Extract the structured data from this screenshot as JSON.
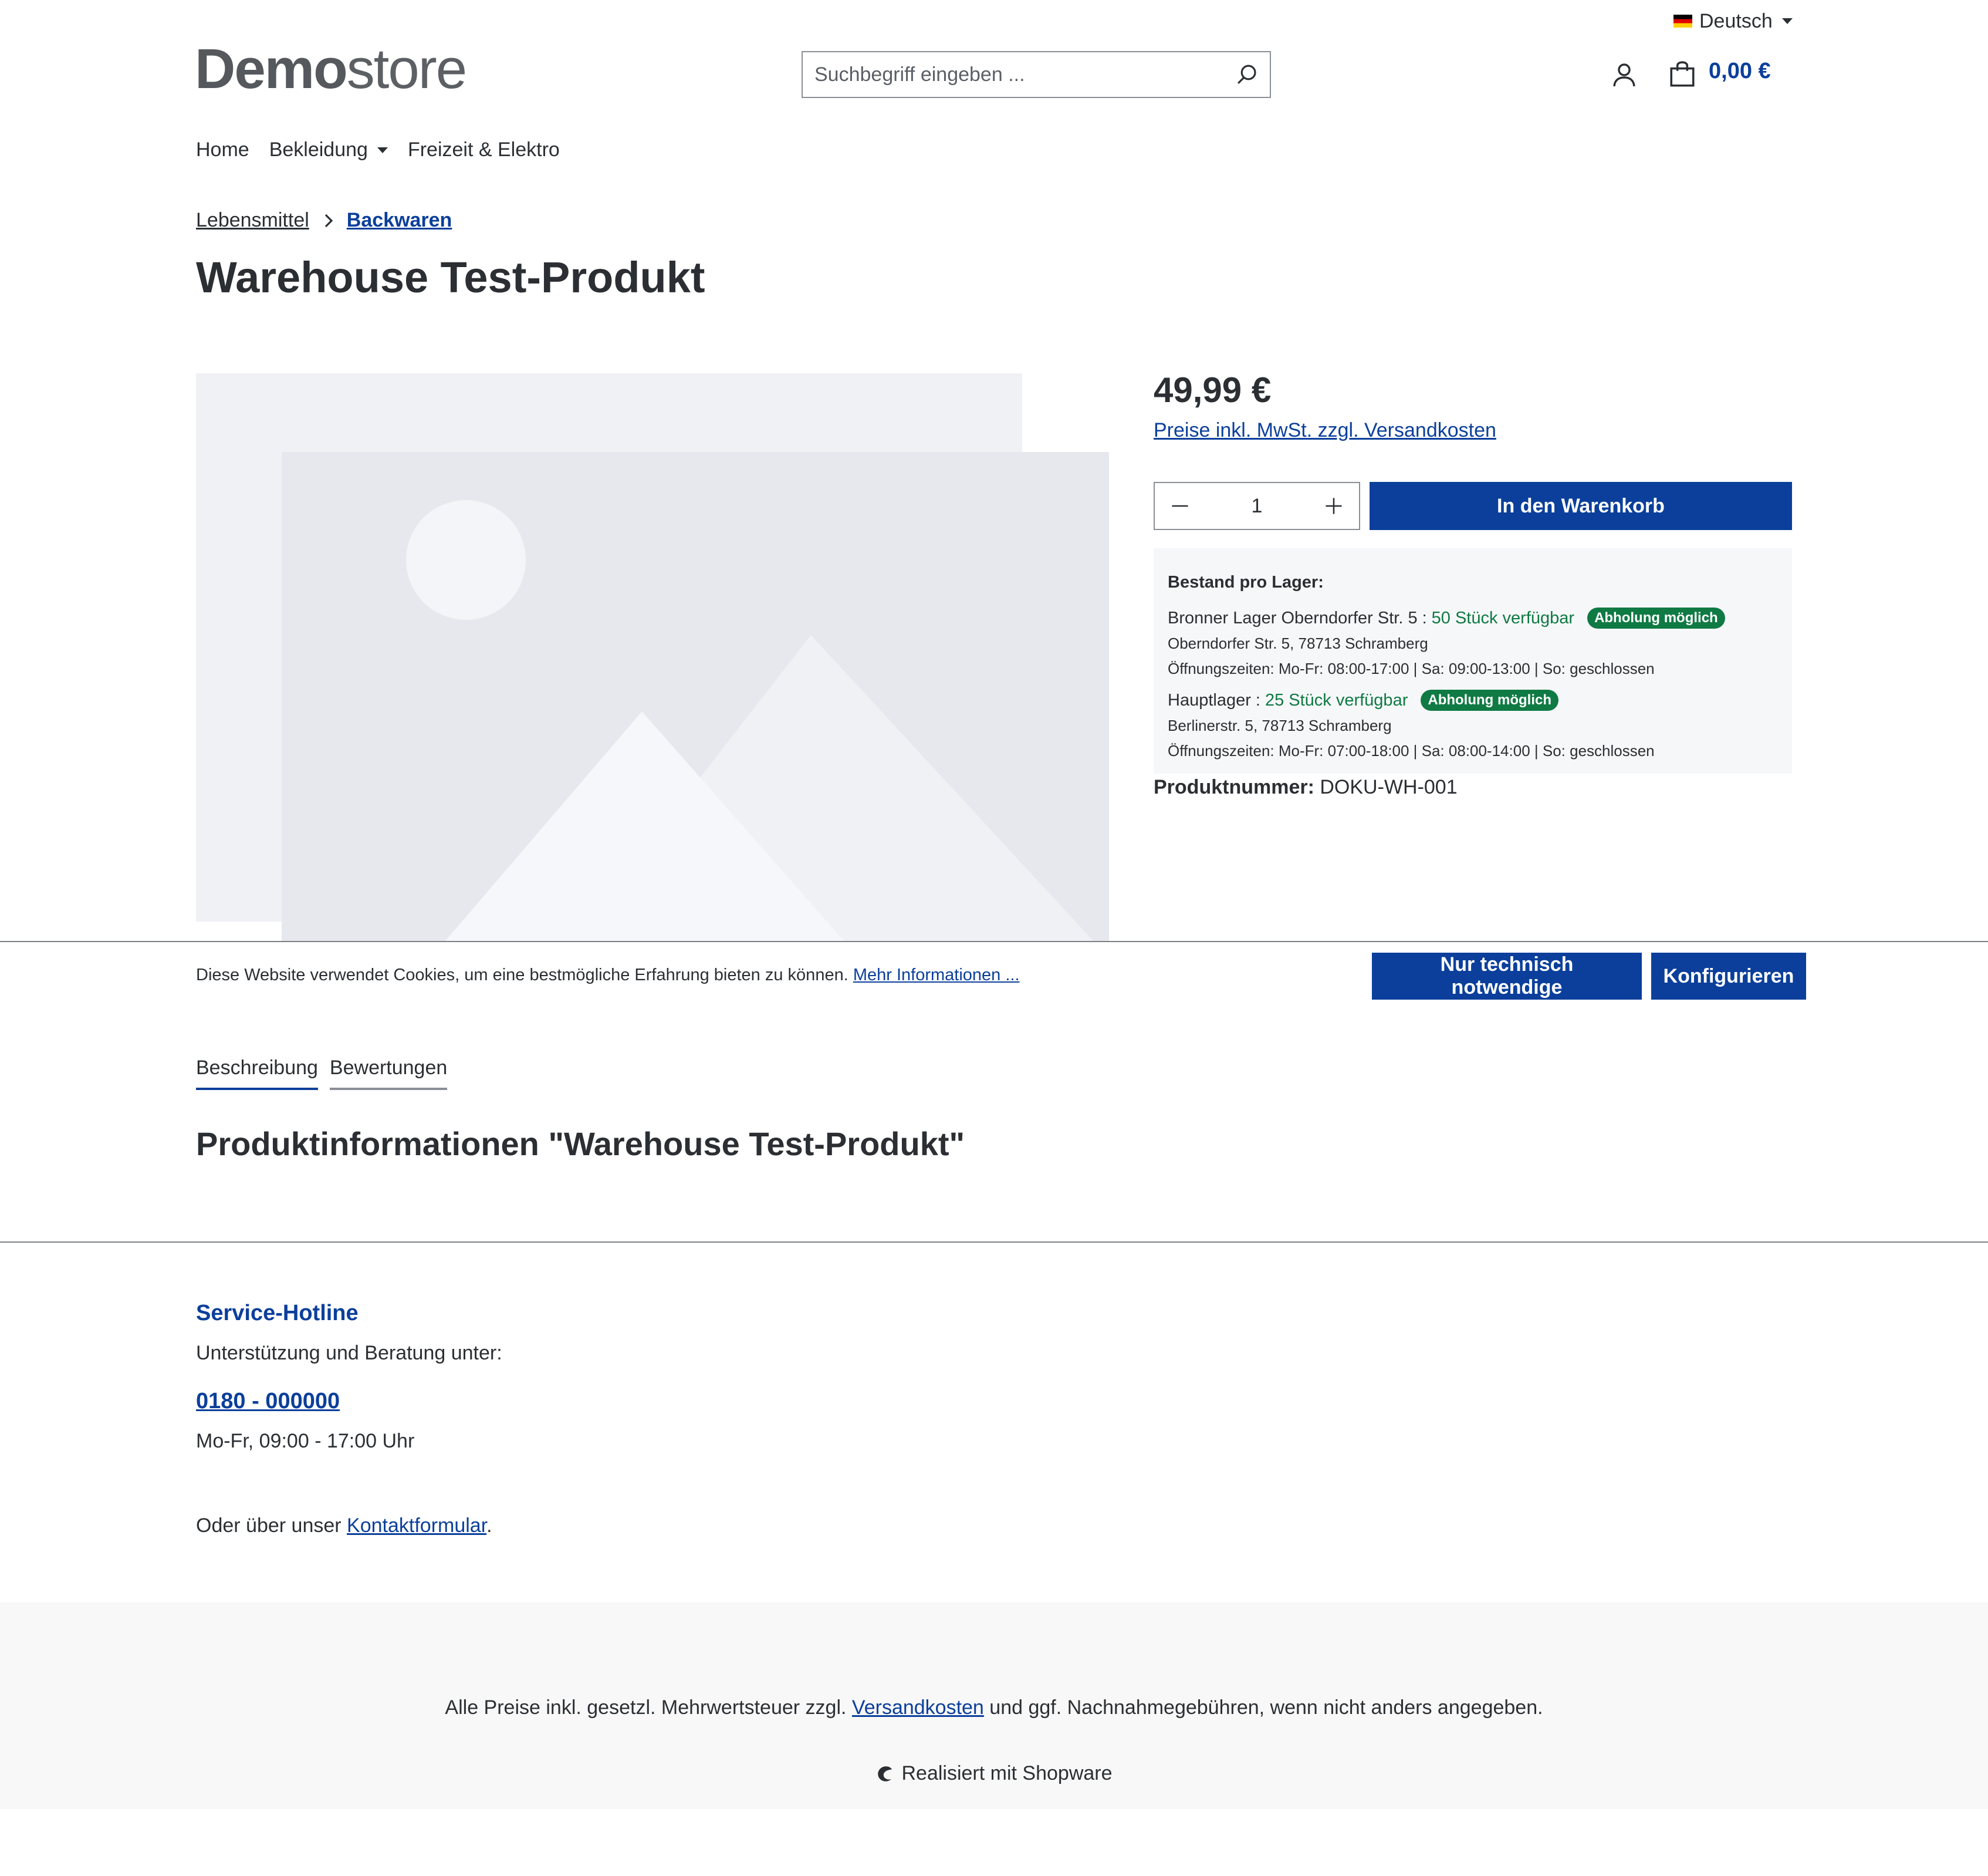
{
  "topbar": {
    "language": "Deutsch"
  },
  "header": {
    "logo_bold": "Demo",
    "logo_light": "store",
    "search_placeholder": "Suchbegriff eingeben ...",
    "cart_total": "0,00 €"
  },
  "nav": {
    "items": [
      "Home",
      "Bekleidung",
      "Freizeit & Elektro"
    ]
  },
  "breadcrumb": {
    "items": [
      "Lebensmittel",
      "Backwaren"
    ]
  },
  "product": {
    "title": "Warehouse Test-Produkt",
    "price": "49,99 €",
    "tax_link": "Preise inkl. MwSt. zzgl. Versandkosten",
    "quantity": "1",
    "buy_label": "In den Warenkorb",
    "stock_header": "Bestand pro Lager:",
    "warehouses": [
      {
        "name": "Bronner Lager Oberndorfer Str. 5",
        "stock": "50 Stück verfügbar",
        "badge": "Abholung möglich",
        "address": "Oberndorfer Str. 5, 78713 Schramberg",
        "hours": "Öffnungszeiten: Mo-Fr: 08:00-17:00 | Sa: 09:00-13:00 | So: geschlossen"
      },
      {
        "name": "Hauptlager",
        "stock": "25 Stück verfügbar",
        "badge": "Abholung möglich",
        "address": "Berlinerstr. 5, 78713 Schramberg",
        "hours": "Öffnungszeiten: Mo-Fr: 07:00-18:00 | Sa: 08:00-14:00 | So: geschlossen"
      }
    ],
    "number_label": "Produktnummer:",
    "number_value": "DOKU-WH-001"
  },
  "cookie": {
    "text": "Diese Website verwendet Cookies, um eine bestmögliche Erfahrung bieten zu können.",
    "link": "Mehr Informationen ...",
    "btn_necessary": "Nur technisch notwendige",
    "btn_configure": "Konfigurieren"
  },
  "tabs": {
    "items": [
      "Beschreibung",
      "Bewertungen"
    ]
  },
  "info": {
    "heading": "Produktinformationen \"Warehouse Test-Produkt\""
  },
  "service": {
    "title": "Service-Hotline",
    "subtitle": "Unterstützung und Beratung unter:",
    "phone": "0180 - 000000",
    "hours": "Mo-Fr, 09:00 - 17:00 Uhr",
    "contact_prefix": "Oder über unser",
    "contact_link": "Kontaktformular",
    "contact_suffix": "."
  },
  "footer": {
    "note_prefix": "Alle Preise inkl. gesetzl. Mehrwertsteuer zzgl.",
    "note_link": "Versandkosten",
    "note_suffix": "und ggf. Nachnahmegebühren, wenn nicht anders angegeben.",
    "made_with": "Realisiert mit Shopware"
  },
  "colors": {
    "primary": "#0b3f9b",
    "success": "#0f7a43",
    "text": "#2b2f33"
  }
}
